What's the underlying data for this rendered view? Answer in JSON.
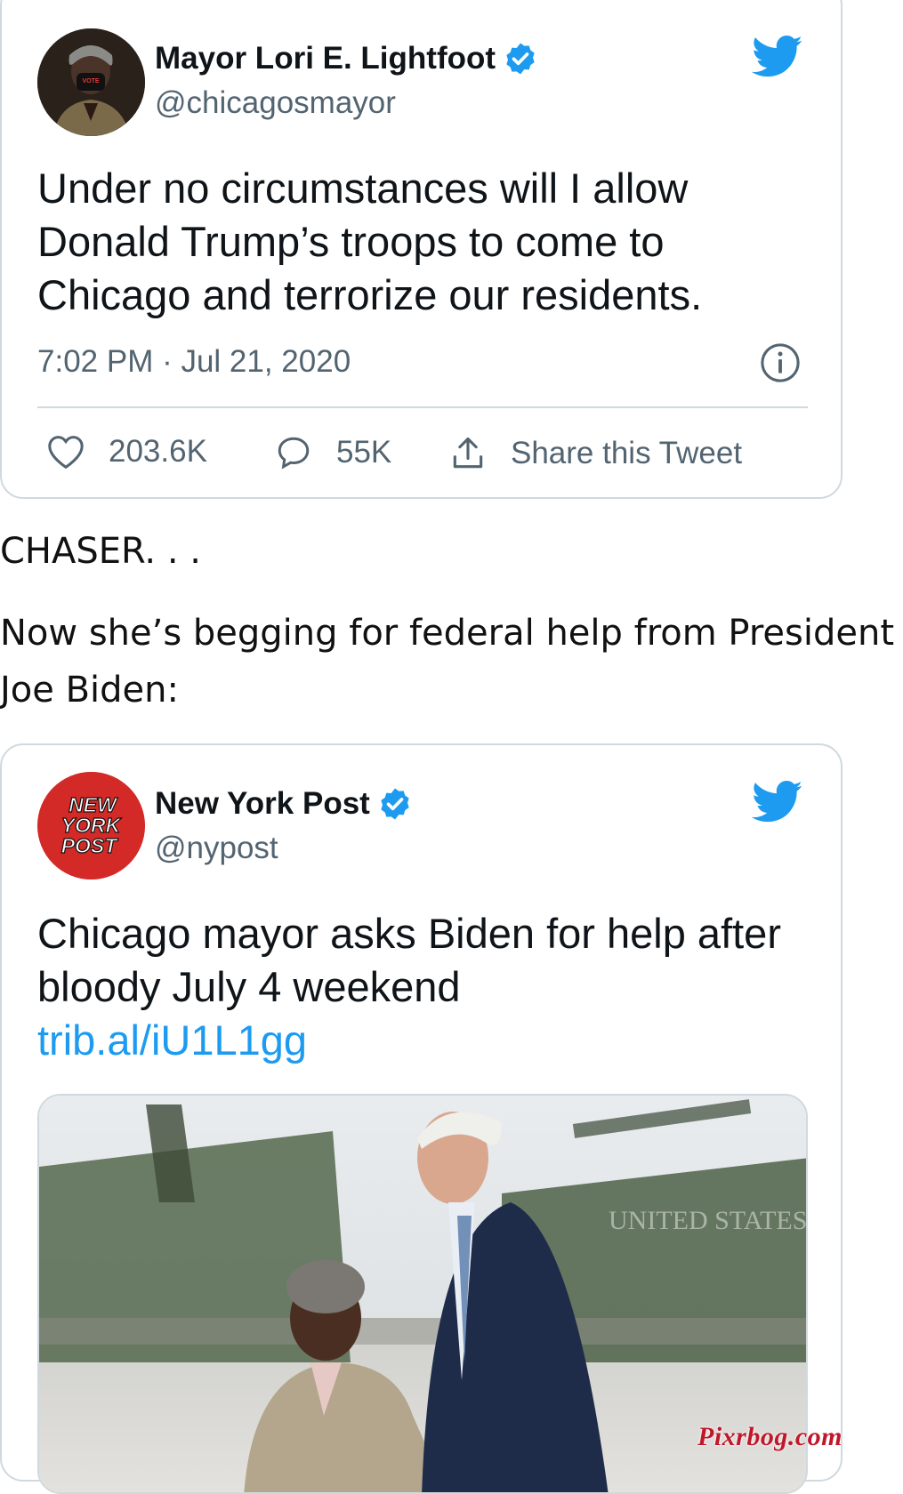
{
  "tweet1": {
    "display_name": "Mayor Lori E. Lightfoot",
    "handle": "@chicagosmayor",
    "text": "Under no circumstances will I allow Donald Trump’s troops to come to Chicago and terrorize our residents.",
    "timestamp": "7:02 PM · Jul 21, 2020",
    "likes": "203.6K",
    "replies": "55K",
    "share_label": "Share this Tweet",
    "mask_text": "VOTE"
  },
  "caption": {
    "line1": "CHASER. . .",
    "line2": "Now she’s begging for federal help from President",
    "line3": "Joe Biden:"
  },
  "tweet2": {
    "display_name": "New York Post",
    "handle": "@nypost",
    "text": "Chicago mayor asks Biden for help after bloody July 4 weekend",
    "link": "trib.al/iU1L1gg",
    "logo_lines": [
      "NEW",
      "YORK",
      "POST"
    ],
    "photo_plane_text": "UNITED STATES"
  },
  "watermark": "Pixrbog.com",
  "colors": {
    "twitter_blue": "#1d9bf0",
    "nypost_red": "#d32a27",
    "secondary_text": "#536471",
    "border": "#cfd9de"
  },
  "icons": [
    "verified-badge-icon",
    "twitter-bird-icon",
    "info-icon",
    "heart-icon",
    "reply-icon",
    "share-icon"
  ]
}
